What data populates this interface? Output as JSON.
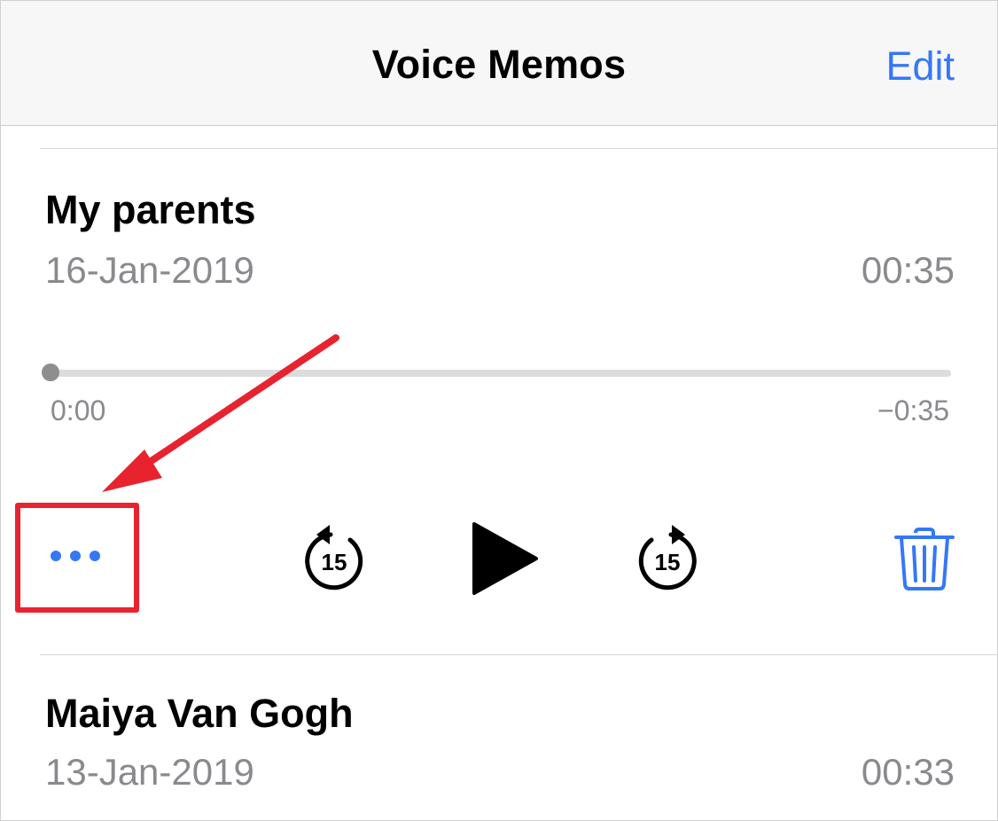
{
  "nav": {
    "title": "Voice Memos",
    "edit_label": "Edit"
  },
  "memos": [
    {
      "title": "My parents",
      "date": "16-Jan-2019",
      "duration": "00:35",
      "player": {
        "elapsed": "0:00",
        "remaining": "−0:35",
        "progress": 0.0,
        "skip_back_label": "15",
        "skip_forward_label": "15"
      }
    },
    {
      "title": "Maiya Van Gogh",
      "date": "13-Jan-2019",
      "duration": "00:33"
    }
  ],
  "colors": {
    "accent": "#3478f6",
    "annotation": "#e8232f",
    "secondary_text": "#8a8a8e"
  },
  "icons": {
    "more": "ellipsis-icon",
    "skip_back": "rewind-15-icon",
    "play": "play-icon",
    "skip_forward": "forward-15-icon",
    "delete": "trash-icon"
  }
}
